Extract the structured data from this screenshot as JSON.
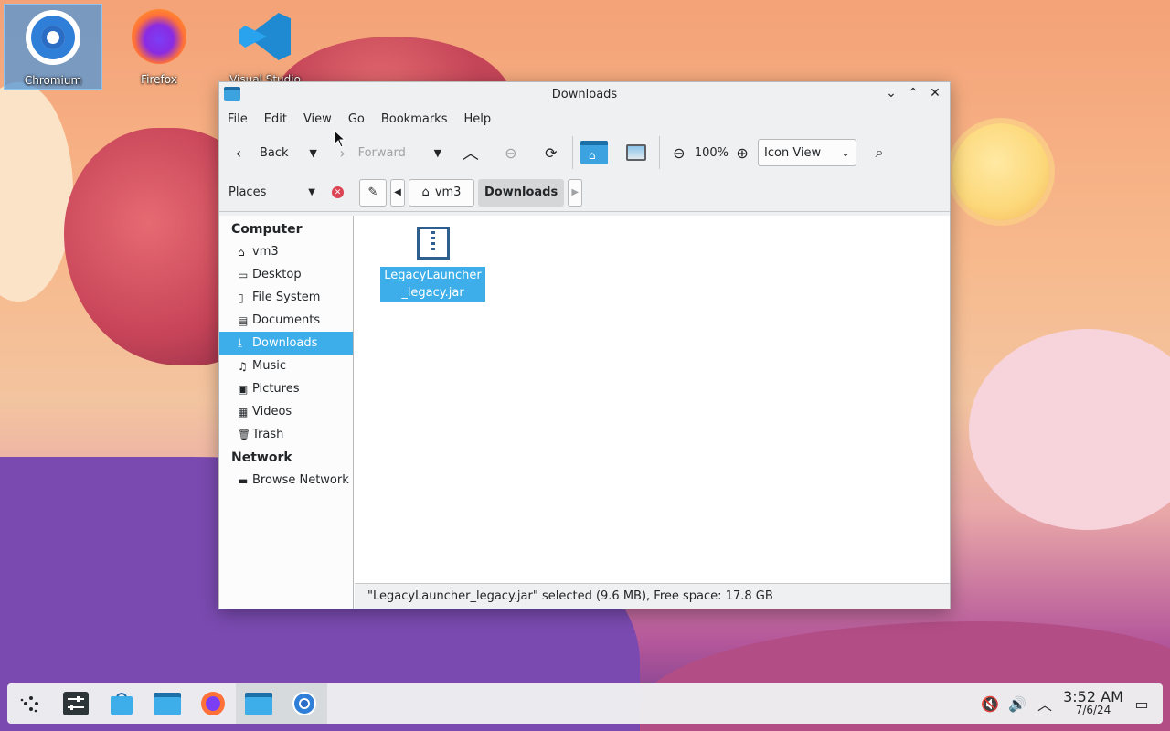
{
  "desktop": {
    "icons": [
      {
        "label": "Chromium",
        "icon": "chromium-icon",
        "selected": true
      },
      {
        "label": "Firefox",
        "icon": "firefox-icon",
        "selected": false
      },
      {
        "label": "Visual Studio",
        "icon": "vscode-icon",
        "selected": false
      }
    ]
  },
  "window": {
    "title": "Downloads",
    "menu": [
      "File",
      "Edit",
      "View",
      "Go",
      "Bookmarks",
      "Help"
    ],
    "toolbar": {
      "back": "Back",
      "forward": "Forward",
      "zoom": "100%",
      "view_mode": "Icon View"
    },
    "places_label": "Places",
    "breadcrumb": [
      "vm3",
      "Downloads"
    ],
    "sidebar": {
      "sections": [
        {
          "title": "Computer",
          "items": [
            {
              "label": "vm3",
              "icon": "home-icon",
              "glyph": "⌂"
            },
            {
              "label": "Desktop",
              "icon": "desktop-icon",
              "glyph": "▭"
            },
            {
              "label": "File System",
              "icon": "drive-icon",
              "glyph": "▯"
            },
            {
              "label": "Documents",
              "icon": "documents-icon",
              "glyph": "▤"
            },
            {
              "label": "Downloads",
              "icon": "download-icon",
              "glyph": "⤓",
              "active": true
            },
            {
              "label": "Music",
              "icon": "music-icon",
              "glyph": "♫"
            },
            {
              "label": "Pictures",
              "icon": "pictures-icon",
              "glyph": "▣"
            },
            {
              "label": "Videos",
              "icon": "videos-icon",
              "glyph": "▦"
            },
            {
              "label": "Trash",
              "icon": "trash-icon",
              "glyph": "🗑"
            }
          ]
        },
        {
          "title": "Network",
          "items": [
            {
              "label": "Browse Network",
              "icon": "network-icon",
              "glyph": "▬"
            }
          ]
        }
      ]
    },
    "files": [
      {
        "name": "LegacyLauncher_legacy.jar",
        "icon": "archive-file-icon",
        "selected": true
      }
    ],
    "status": "\"LegacyLauncher_legacy.jar\" selected (9.6 MB), Free space: 17.8 GB"
  },
  "taskbar": {
    "apps": [
      {
        "icon": "app-launcher-icon",
        "active": false
      },
      {
        "icon": "system-settings-icon",
        "active": false
      },
      {
        "icon": "discover-store-icon",
        "active": false
      },
      {
        "icon": "file-manager-icon",
        "active": false
      },
      {
        "icon": "firefox-icon",
        "active": false
      },
      {
        "icon": "pcmanfm-icon",
        "active": true
      },
      {
        "icon": "chromium-icon",
        "active": true
      }
    ],
    "clock_time": "3:52 AM",
    "clock_date": "7/6/24"
  }
}
